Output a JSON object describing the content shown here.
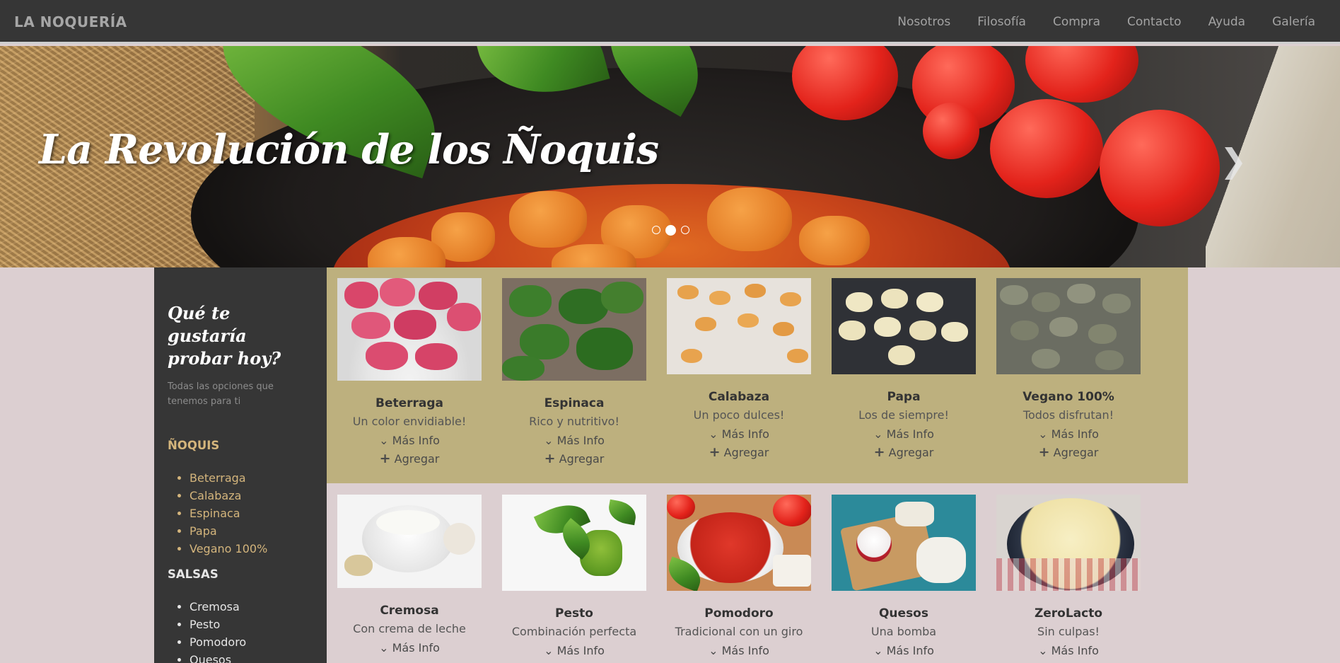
{
  "brand": "LA NOQUERÍA",
  "nav": [
    "Nosotros",
    "Filosofía",
    "Compra",
    "Contacto",
    "Ayuda",
    "Galería"
  ],
  "hero": {
    "title": "La Revolución de los Ñoquis",
    "next_icon": "chevron-right-icon",
    "slides_total": 3,
    "active_slide": 2
  },
  "sidebar": {
    "title": "Qué te gustaría probar hoy?",
    "subtitle": "Todas las opciones que tenemos para ti",
    "sections": [
      {
        "heading": "ÑOQUIS",
        "items": [
          "Beterraga",
          "Calabaza",
          "Espinaca",
          "Papa",
          "Vegano 100%"
        ]
      },
      {
        "heading": "SALSAS",
        "items": [
          "Cremosa",
          "Pesto",
          "Pomodoro",
          "Quesos"
        ]
      }
    ]
  },
  "actions": {
    "info": "Más Info",
    "add": "Agregar",
    "info_icon": "chevron-down-icon",
    "add_icon": "plus-icon"
  },
  "gnocchi": [
    {
      "name": "Beterraga",
      "desc": "Un color envidiable!"
    },
    {
      "name": "Espinaca",
      "desc": "Rico y nutritivo!"
    },
    {
      "name": "Calabaza",
      "desc": "Un poco dulces!"
    },
    {
      "name": "Papa",
      "desc": "Los de siempre!"
    },
    {
      "name": "Vegano 100%",
      "desc": "Todos disfrutan!"
    }
  ],
  "sauces": [
    {
      "name": "Cremosa",
      "desc": "Con crema de leche"
    },
    {
      "name": "Pesto",
      "desc": "Combinación perfecta"
    },
    {
      "name": "Pomodoro",
      "desc": "Tradicional con un giro"
    },
    {
      "name": "Quesos",
      "desc": "Una bomba"
    },
    {
      "name": "ZeroLacto",
      "desc": "Sin culpas!"
    }
  ],
  "colors": {
    "nav_bg": "#363636",
    "accent_gold": "#d4b57c",
    "row_bg": "#bdb07e",
    "page_bg": "#dccfd1"
  }
}
